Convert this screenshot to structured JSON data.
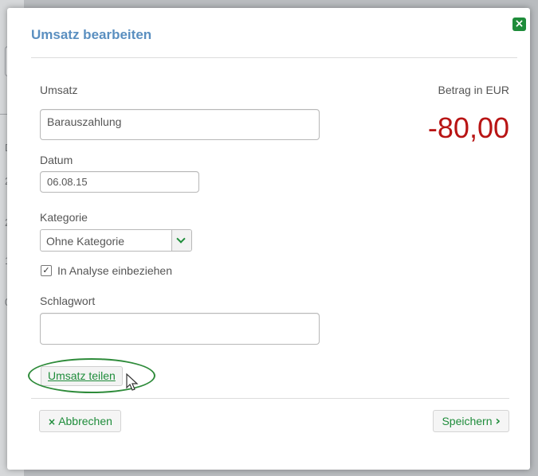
{
  "background": {
    "fragments": [
      "D",
      "2",
      "2",
      "1",
      "0"
    ]
  },
  "dialog": {
    "title": "Umsatz bearbeiten",
    "close_icon": "close-icon",
    "umsatz": {
      "label": "Umsatz",
      "value": "Barauszahlung"
    },
    "betrag": {
      "label": "Betrag in EUR",
      "value": "-80,00"
    },
    "datum": {
      "label": "Datum",
      "value": "06.08.15"
    },
    "kategorie": {
      "label": "Kategorie",
      "selected": "Ohne Kategorie"
    },
    "analyse": {
      "label": "In Analyse einbeziehen",
      "checked": true
    },
    "schlagwort": {
      "label": "Schlagwort",
      "value": ""
    },
    "split_label": "Umsatz teilen",
    "cancel": {
      "icon": "×",
      "label": "Abbrechen"
    },
    "save": {
      "label": "Speichern",
      "icon": "›"
    }
  },
  "colors": {
    "accent_green": "#1e8c3a",
    "title_blue": "#5a8fc0",
    "amount_red": "#b81414"
  }
}
